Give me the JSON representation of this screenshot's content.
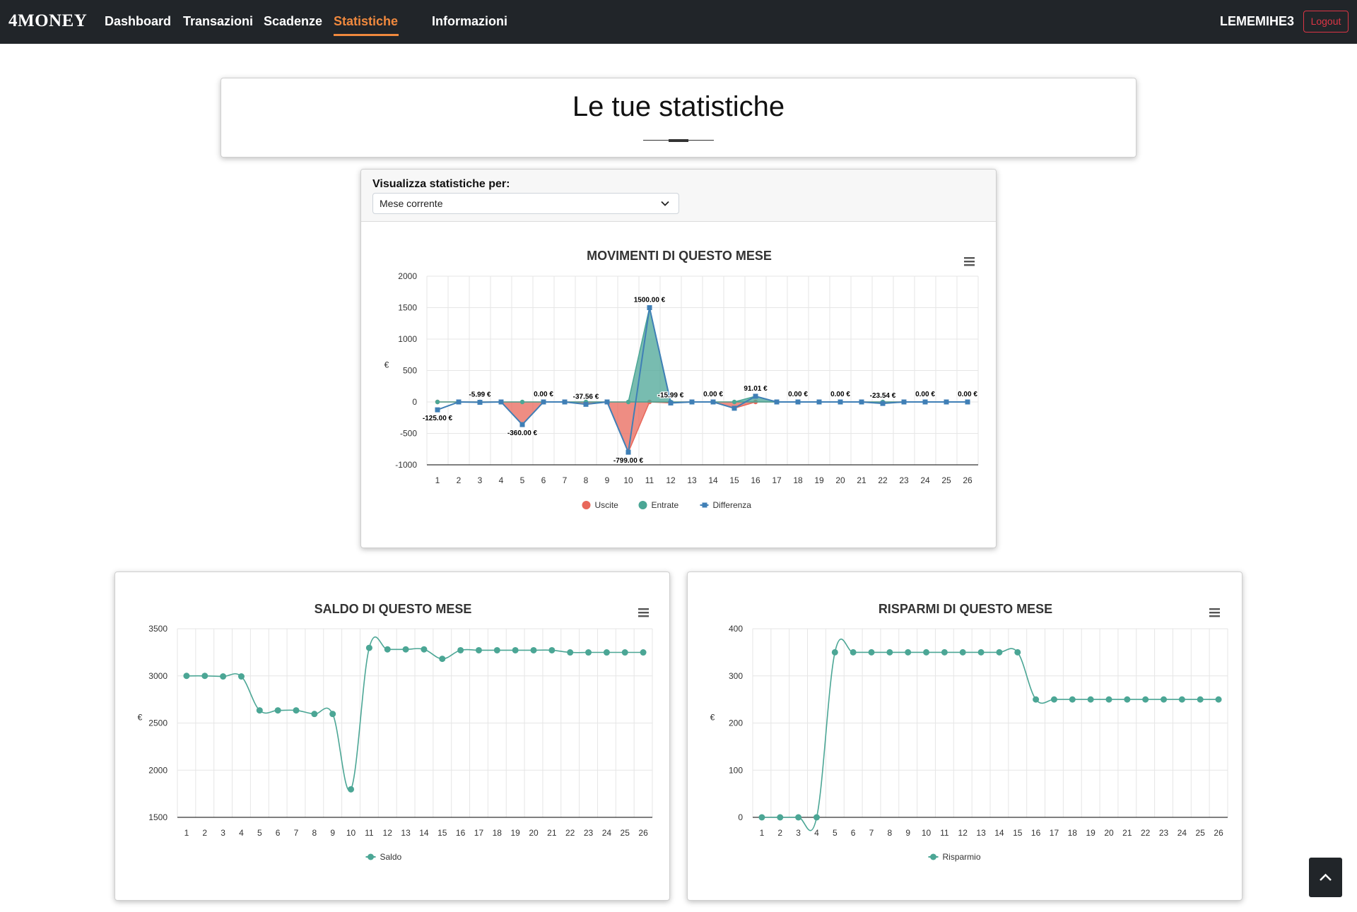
{
  "brand": "4MONEY",
  "nav": {
    "items": [
      {
        "label": "Dashboard",
        "active": false
      },
      {
        "label": "Transazioni",
        "active": false
      },
      {
        "label": "Scadenze",
        "active": false
      },
      {
        "label": "Statistiche",
        "active": true
      },
      {
        "label": "Informazioni",
        "active": false
      }
    ],
    "username": "LEMEMIHE3",
    "logout_label": "Logout"
  },
  "page": {
    "title": "Le tue statistiche"
  },
  "filter": {
    "label": "Visualizza statistiche per:",
    "selected": "Mese corrente"
  },
  "colors": {
    "accent": "#f0893e",
    "uscite": "#e8675a",
    "entrate": "#4ba695",
    "differenza": "#3f7fb6",
    "logout": "#dc3545",
    "navbar": "#212529"
  },
  "icons": {
    "menu": "hamburger-menu-icon",
    "select": "chevron-down-icon",
    "scroll": "chevron-up-icon"
  },
  "chart_data": [
    {
      "type": "area",
      "title": "MOVIMENTI DI QUESTO MESE",
      "ylabel": "€",
      "ylim": [
        -1000,
        2000
      ],
      "yticks": [
        2000,
        1500,
        1000,
        500,
        0,
        -500,
        -1000
      ],
      "grid": true,
      "legend": "bottom-center",
      "categories": [
        "1",
        "2",
        "3",
        "4",
        "5",
        "6",
        "7",
        "8",
        "9",
        "10",
        "11",
        "12",
        "13",
        "14",
        "15",
        "16",
        "17",
        "18",
        "19",
        "20",
        "21",
        "22",
        "23",
        "24",
        "25",
        "26"
      ],
      "series": [
        {
          "name": "Uscite",
          "color": "#e8675a",
          "values": [
            0,
            0,
            0,
            0,
            -360,
            0,
            0,
            -37.56,
            0,
            -799,
            0,
            -15.99,
            0,
            0,
            -100,
            0,
            0,
            0,
            0,
            0,
            0,
            -23.54,
            0,
            0,
            0,
            0
          ]
        },
        {
          "name": "Entrate",
          "color": "#4ba695",
          "values": [
            0,
            0,
            0,
            0,
            0,
            0,
            0,
            0,
            0,
            0,
            1500,
            0,
            0,
            0,
            0,
            91.01,
            0,
            0,
            0,
            0,
            0,
            0,
            0,
            0,
            0,
            0
          ]
        },
        {
          "name": "Differenza",
          "color": "#3f7fb6",
          "values": [
            -125,
            0,
            -5.99,
            0,
            -360,
            0,
            0,
            -37.56,
            0,
            -799,
            1500,
            -15.99,
            0,
            0,
            -100,
            91.01,
            0,
            0,
            0,
            0,
            0,
            -23.54,
            0,
            0,
            0,
            0
          ]
        }
      ],
      "data_labels": [
        {
          "index": 0,
          "text": "-125.00 €"
        },
        {
          "index": 2,
          "text": "-5.99 €"
        },
        {
          "index": 4,
          "text": "-360.00 €"
        },
        {
          "index": 5,
          "text": "0.00 €"
        },
        {
          "index": 7,
          "text": "-37.56 €"
        },
        {
          "index": 9,
          "text": "-799.00 €"
        },
        {
          "index": 10,
          "text": "1500.00 €"
        },
        {
          "index": 11,
          "text": "-15.99 €"
        },
        {
          "index": 13,
          "text": "0.00 €"
        },
        {
          "index": 15,
          "text": "91.01 €"
        },
        {
          "index": 17,
          "text": "0.00 €"
        },
        {
          "index": 19,
          "text": "0.00 €"
        },
        {
          "index": 21,
          "text": "-23.54 €"
        },
        {
          "index": 23,
          "text": "0.00 €"
        },
        {
          "index": 25,
          "text": "0.00 €"
        }
      ]
    },
    {
      "type": "line",
      "title": "SALDO DI QUESTO MESE",
      "ylabel": "€",
      "ylim": [
        1500,
        3500
      ],
      "yticks": [
        3500,
        3000,
        2500,
        2000,
        1500
      ],
      "grid": true,
      "legend": "bottom-center",
      "categories": [
        "1",
        "2",
        "3",
        "4",
        "5",
        "6",
        "7",
        "8",
        "9",
        "10",
        "11",
        "12",
        "13",
        "14",
        "15",
        "16",
        "17",
        "18",
        "19",
        "20",
        "21",
        "22",
        "23",
        "24",
        "25",
        "26"
      ],
      "series": [
        {
          "name": "Saldo",
          "color": "#4ba695",
          "values": [
            3000,
            3000,
            2994,
            2994,
            2634,
            2634,
            2634,
            2596,
            2596,
            1797,
            3297,
            3281,
            3281,
            3281,
            3181,
            3272,
            3272,
            3272,
            3272,
            3272,
            3272,
            3249,
            3249,
            3249,
            3249,
            3249
          ]
        }
      ]
    },
    {
      "type": "line",
      "title": "RISPARMI DI QUESTO MESE",
      "ylabel": "€",
      "ylim": [
        0,
        400
      ],
      "yticks": [
        400,
        300,
        200,
        100,
        0
      ],
      "grid": true,
      "legend": "bottom-center",
      "categories": [
        "1",
        "2",
        "3",
        "4",
        "5",
        "6",
        "7",
        "8",
        "9",
        "10",
        "11",
        "12",
        "13",
        "14",
        "15",
        "16",
        "17",
        "18",
        "19",
        "20",
        "21",
        "22",
        "23",
        "24",
        "25",
        "26"
      ],
      "series": [
        {
          "name": "Risparmio",
          "color": "#4ba695",
          "values": [
            0,
            0,
            0,
            0,
            350,
            350,
            350,
            350,
            350,
            350,
            350,
            350,
            350,
            350,
            350,
            250,
            250,
            250,
            250,
            250,
            250,
            250,
            250,
            250,
            250,
            250
          ]
        }
      ]
    }
  ]
}
